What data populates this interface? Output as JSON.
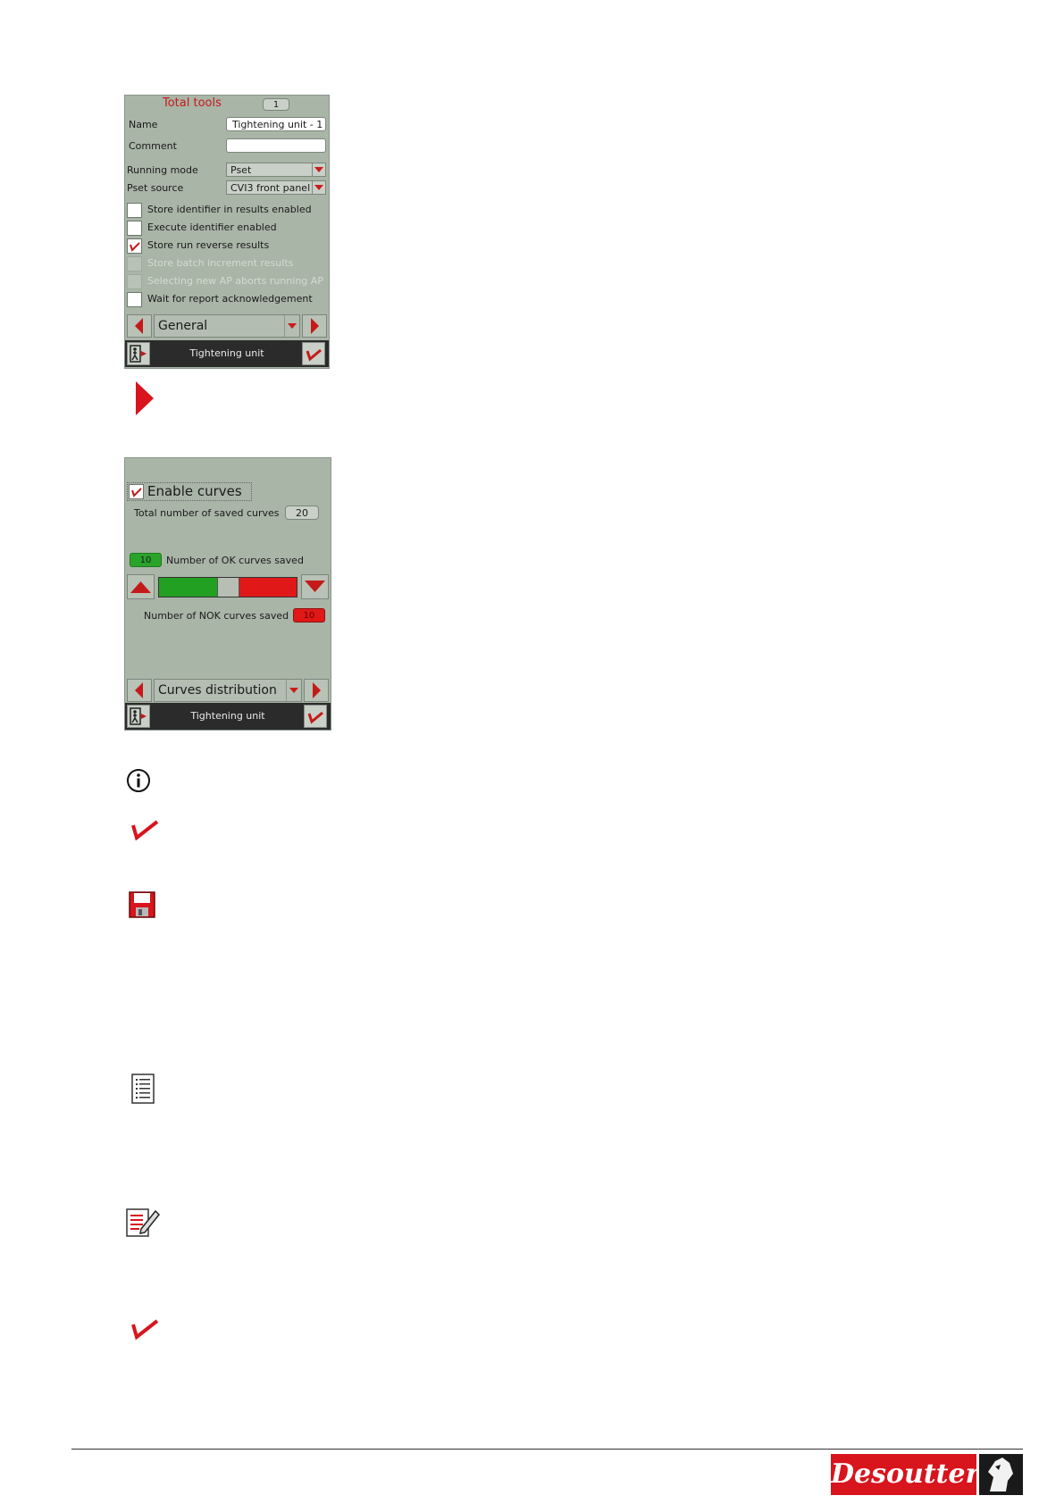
{
  "panel1": {
    "title": "Total tools",
    "total_tools": "1",
    "name_label": "Name",
    "name_value": "Tightening unit - 1",
    "comment_label": "Comment",
    "comment_value": "",
    "running_mode_label": "Running mode",
    "running_mode_value": "Pset",
    "pset_source_label": "Pset source",
    "pset_source_value": "CVI3 front panel",
    "checkboxes": [
      {
        "label": "Store identifier in results enabled",
        "checked": false,
        "enabled": true
      },
      {
        "label": "Execute identifier enabled",
        "checked": false,
        "enabled": true
      },
      {
        "label": "Store run reverse results",
        "checked": true,
        "enabled": true
      },
      {
        "label": "Store batch increment results",
        "checked": false,
        "enabled": false
      },
      {
        "label": "Selecting new AP aborts running AP",
        "checked": false,
        "enabled": false
      },
      {
        "label": "Wait for report acknowledgement",
        "checked": false,
        "enabled": true
      }
    ],
    "section": "General",
    "footer_title": "Tightening unit"
  },
  "panel2": {
    "enable_curves_label": "Enable curves",
    "enable_curves_checked": true,
    "total_curves_label": "Total number of saved curves",
    "total_curves_value": "20",
    "ok_curves_value": "10",
    "ok_curves_label": "Number of OK curves saved",
    "nok_curves_label": "Number of NOK curves saved",
    "nok_curves_value": "10",
    "distribution_ok_fraction": 0.5,
    "section": "Curves distribution",
    "footer_title": "Tightening unit"
  },
  "doc_icons": [
    "arrow-right-icon",
    "info-icon",
    "checkmark-icon",
    "save-icon",
    "list-icon",
    "edit-list-icon",
    "checkmark-icon"
  ],
  "brand": {
    "name": "Desoutter",
    "red": "#d8141c"
  }
}
